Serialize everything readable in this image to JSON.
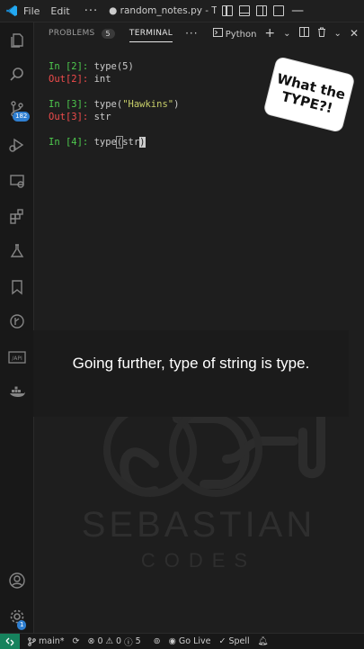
{
  "titlebar": {
    "menu": [
      "File",
      "Edit"
    ],
    "more": "···",
    "title": "● random_notes.py - T..."
  },
  "activity": {
    "scm_badge": "182",
    "settings_badge": "1"
  },
  "panel": {
    "tabs": [
      {
        "label": "PROBLEMS",
        "count": "5"
      },
      {
        "label": "TERMINAL"
      }
    ],
    "more": "···",
    "profile": "Python"
  },
  "terminal": {
    "lines": [
      {
        "prompt": "In [2]: ",
        "code": "type(5)"
      },
      {
        "prompt": "Out[2]: ",
        "code": "int"
      },
      {
        "prompt": "In [3]: ",
        "code_pre": "type(",
        "code_str": "\"Hawkins\"",
        "code_post": ")"
      },
      {
        "prompt": "Out[3]: ",
        "code": "str"
      },
      {
        "prompt": "In [4]: ",
        "code_pre": "type",
        "code_bracket": "(",
        "code_mid": "str",
        "code_cursor": ")"
      }
    ]
  },
  "sticker": {
    "line1": "What the",
    "line2": "TYPE?!"
  },
  "caption": "Going further, type of string is type.",
  "watermark": {
    "line1": "SEBASTIAN",
    "line2": "CODES"
  },
  "statusbar": {
    "branch": "main*",
    "errors": "0",
    "warnings": "0",
    "infos": "5",
    "golive": "Go Live",
    "spell": "Spell"
  },
  "colors": {
    "accent": "#2f7fd1",
    "prompt_in": "#4ec94e",
    "prompt_out": "#f14c4c",
    "remote": "#16825d"
  }
}
